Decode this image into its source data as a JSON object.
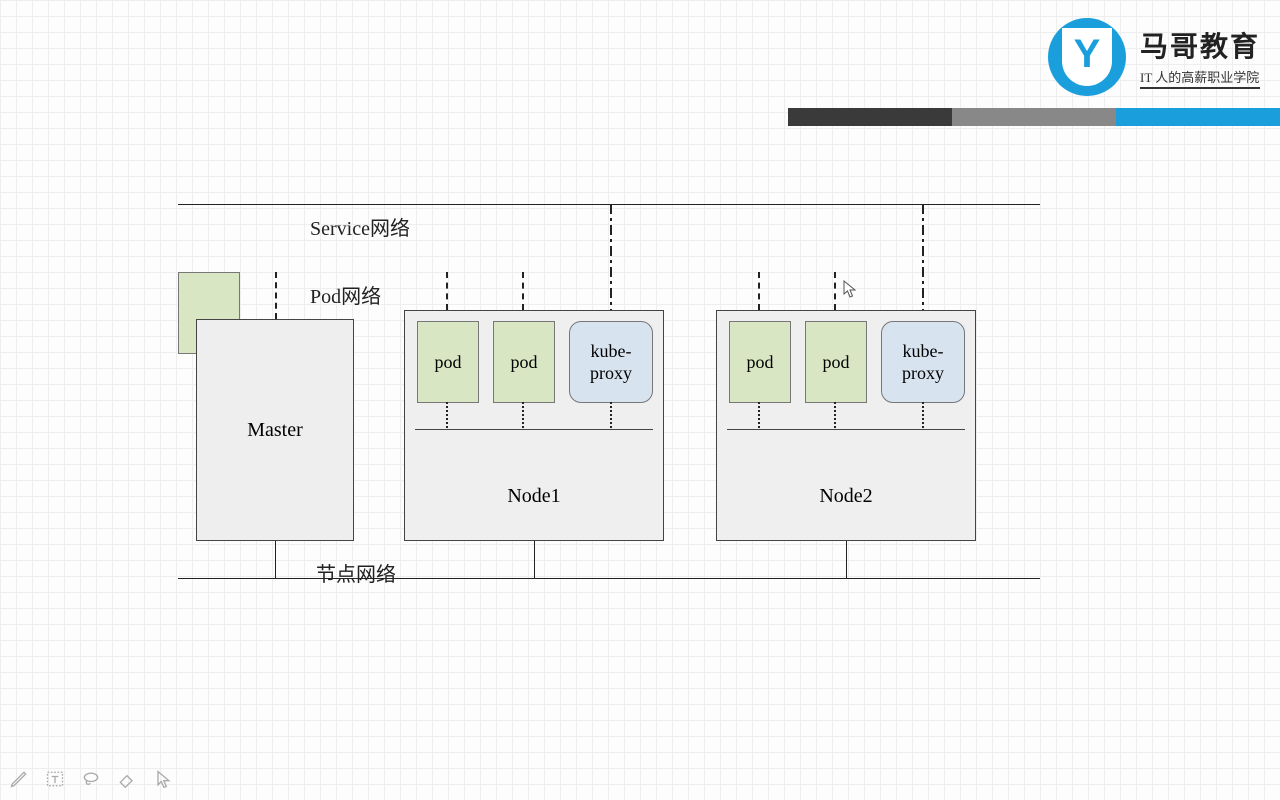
{
  "brand": {
    "title": "马哥教育",
    "subtitle": "IT 人的高薪职业学院"
  },
  "networks": {
    "service_label": "Service网络",
    "pod_label": "Pod网络",
    "node_label": "节点网络"
  },
  "master": {
    "label": "Master"
  },
  "node1": {
    "label": "Node1",
    "pod1": "pod",
    "pod2": "pod",
    "kubeproxy": "kube-\nproxy"
  },
  "node2": {
    "label": "Node2",
    "pod1": "pod",
    "pod2": "pod",
    "kubeproxy": "kube-\nproxy"
  },
  "colors": {
    "accent": "#1a9fdc",
    "pod_fill": "#d9e6c3",
    "kp_fill": "#d7e3ef",
    "box_fill": "#eeeeee"
  }
}
